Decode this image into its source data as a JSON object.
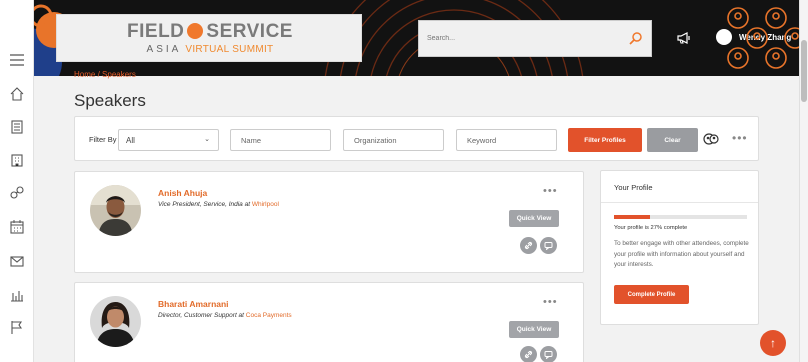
{
  "app": {
    "logo_main_left": "FIELD",
    "logo_main_right": "SERVICE",
    "logo_sub_region": "ASIA",
    "logo_sub_event": "VIRTUAL SUMMIT",
    "brand_color": "#e2522b"
  },
  "header": {
    "search_placeholder": "Search...",
    "user_name": "Wendy Zhang",
    "icons": [
      "search-icon",
      "megaphone-icon",
      "people-grid-icon"
    ]
  },
  "sidebar": {
    "items": [
      {
        "icon": "menu-icon"
      },
      {
        "icon": "home-icon"
      },
      {
        "icon": "agenda-icon"
      },
      {
        "icon": "building-icon"
      },
      {
        "icon": "networking-icon"
      },
      {
        "icon": "calendar-icon"
      },
      {
        "icon": "mail-icon"
      },
      {
        "icon": "bar-chart-icon"
      },
      {
        "icon": "flag-icon"
      }
    ]
  },
  "breadcrumb": {
    "home": "Home",
    "sep": "/",
    "current": "Speakers"
  },
  "page": {
    "title": "Speakers"
  },
  "filter": {
    "label": "Filter By",
    "select_value": "All",
    "name_placeholder": "Name",
    "org_placeholder": "Organization",
    "keyword_placeholder": "Keyword",
    "filter_button": "Filter Profiles",
    "clear_button": "Clear",
    "more": "•••"
  },
  "speakers": [
    {
      "name": "Anish Ahuja",
      "role": "Vice President, Service, India at ",
      "org": "Whirlpool",
      "quick_view": "Quick View",
      "more": "•••"
    },
    {
      "name": "Bharati Amarnani",
      "role": "Director, Customer Support at ",
      "org": "Coca Payments",
      "quick_view": "Quick View",
      "more": "•••"
    }
  ],
  "profile": {
    "title": "Your Profile",
    "progress": 27,
    "progress_text": "Your profile is 27% complete",
    "description": "To better engage with other attendees, complete your profile with information about yourself and your interests.",
    "button": "Complete Profile"
  },
  "fab": {
    "icon": "arrow-up-icon",
    "glyph": "↑"
  }
}
